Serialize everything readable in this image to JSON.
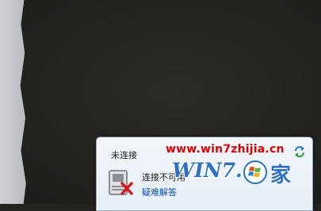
{
  "popup": {
    "title": "未连接",
    "status": "连接不可用",
    "troubleshoot_link": "疑难解答"
  },
  "watermark": {
    "url": "www.win7zhijia.cn",
    "logo_text": "WIN7.",
    "logo_char": "家",
    "url_color": "#e00000",
    "logo_color": "#2d6fc0"
  },
  "icons": {
    "refresh": "refresh-icon",
    "network": "network-disconnected-icon",
    "logo_flag": "windows-flag-icon"
  }
}
